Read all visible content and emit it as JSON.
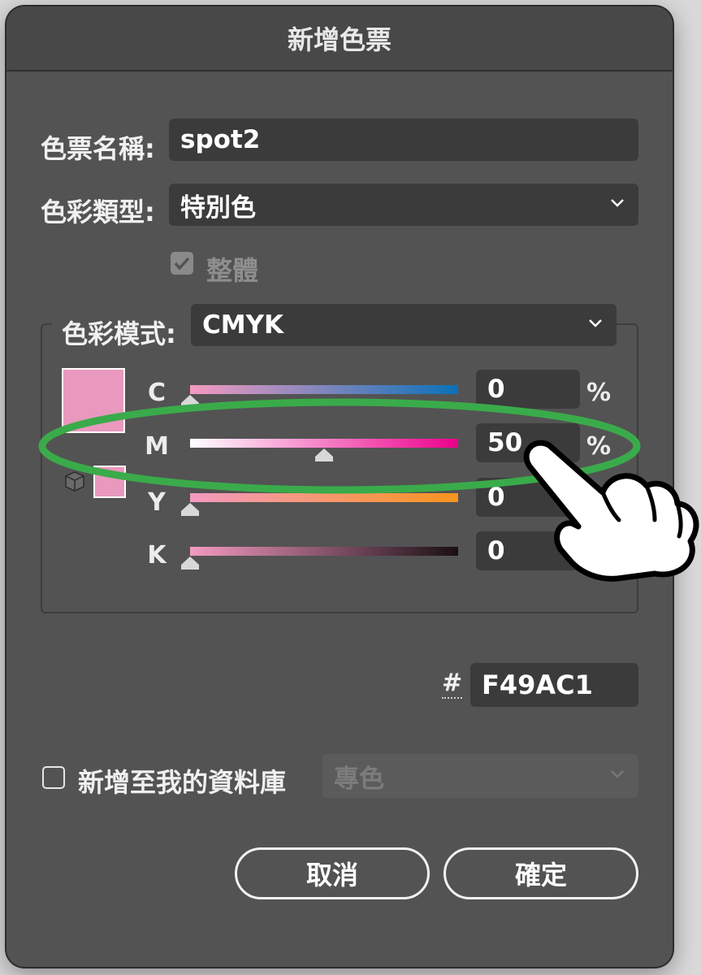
{
  "dialog": {
    "title": "新增色票"
  },
  "swatch_name": {
    "label": "色票名稱:",
    "value": "spot2"
  },
  "color_type": {
    "label": "色彩類型:",
    "value": "特別色"
  },
  "global": {
    "label": "整體",
    "checked": true,
    "disabled": true
  },
  "color_mode": {
    "label": "色彩模式:",
    "value": "CMYK"
  },
  "channels": [
    {
      "name": "C",
      "value": "0",
      "unit": "%",
      "level": 0
    },
    {
      "name": "M",
      "value": "50",
      "unit": "%",
      "level": 50
    },
    {
      "name": "Y",
      "value": "0",
      "unit": "",
      "level": 0
    },
    {
      "name": "K",
      "value": "0",
      "unit": "",
      "level": 0
    }
  ],
  "hex": {
    "symbol": "#",
    "value": "F49AC1"
  },
  "library": {
    "label": "新增至我的資料庫",
    "checked": false,
    "dropdown_value": "專色"
  },
  "buttons": {
    "cancel": "取消",
    "ok": "確定"
  },
  "colors": {
    "swatch": "#F49AC1",
    "dialog_bg": "#535353",
    "field_bg": "#3b3b3b",
    "highlight": "#3aab4a"
  },
  "icons": {
    "gamut": "cube-icon",
    "dropdown": "chevron-down-icon",
    "pointer": "hand-pointer-icon"
  }
}
